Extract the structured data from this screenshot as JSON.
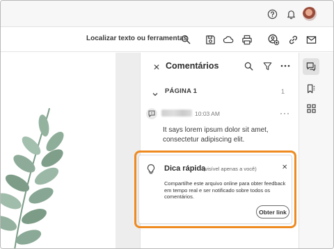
{
  "topbar": {
    "help_icon": "help-circle-icon",
    "bell_icon": "bell-icon",
    "avatar_icon": "user-avatar"
  },
  "toolbar": {
    "find_label": "Localizar texto ou ferramentas",
    "icons": [
      "search-icon",
      "save-icon",
      "cloud-icon",
      "print-icon",
      "add-user-icon",
      "link-icon",
      "mail-icon"
    ]
  },
  "panel": {
    "title": "Comentários",
    "count": "1",
    "page_label": "PÁGINA 1",
    "page_count": "1",
    "comment": {
      "time": "10:03 AM",
      "text": "It says lorem ipsum dolor sit amet, consectetur adipiscing elit.",
      "more": "···"
    }
  },
  "tip": {
    "title": "Dica rápida",
    "subtitle": "(visível apenas a você)",
    "body": "Compartilhe este arquivo online para obter feedback em tempo real e ser notificado sobre todos os comentários.",
    "button": "Obter link",
    "highlight_color": "#ee8a1f"
  },
  "rail": {
    "icons": [
      "comments-icon",
      "bookmark-icon",
      "grid-icon"
    ]
  }
}
